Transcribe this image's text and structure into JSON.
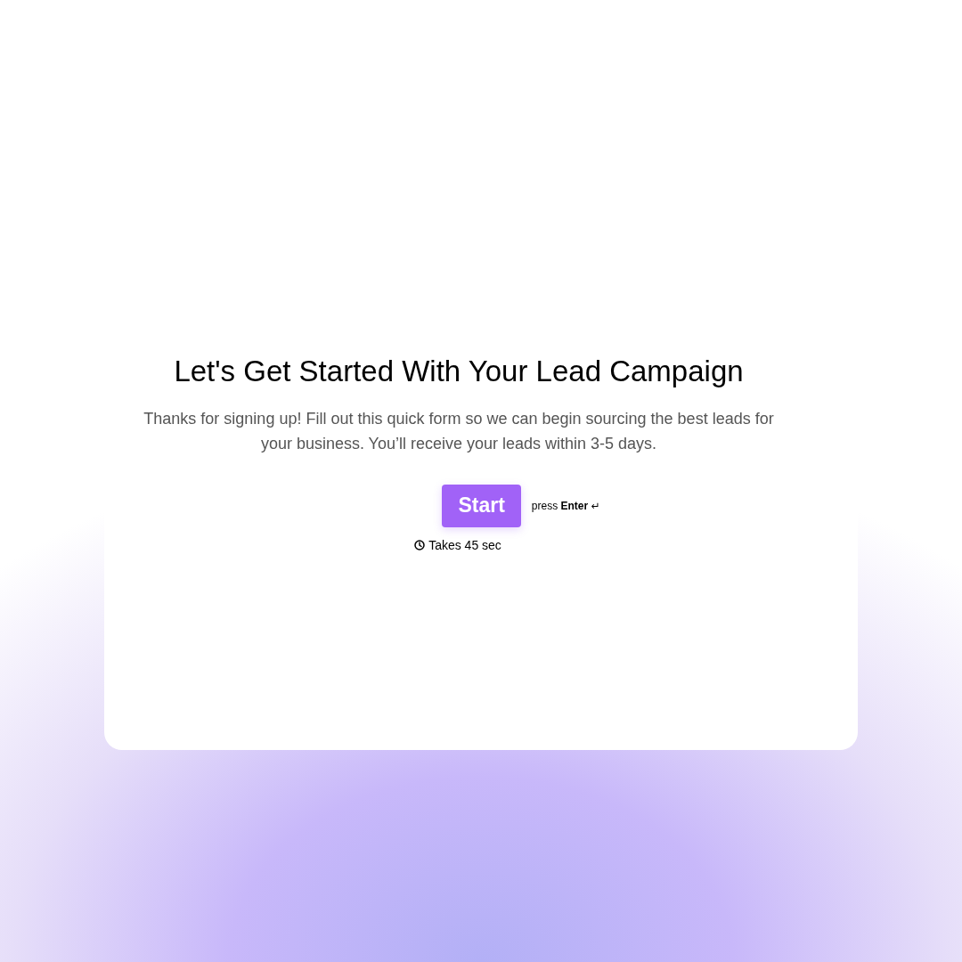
{
  "title": "Let's Get Started With Your Lead Campaign",
  "description": "Thanks for signing up! Fill out this quick form so we can begin sourcing the best leads for your business. You’ll receive your leads within 3-5 days.",
  "start_button": {
    "label": "Start"
  },
  "hint": {
    "prefix": "press",
    "key": "Enter",
    "symbol": "↵"
  },
  "duration": "Takes 45 sec"
}
